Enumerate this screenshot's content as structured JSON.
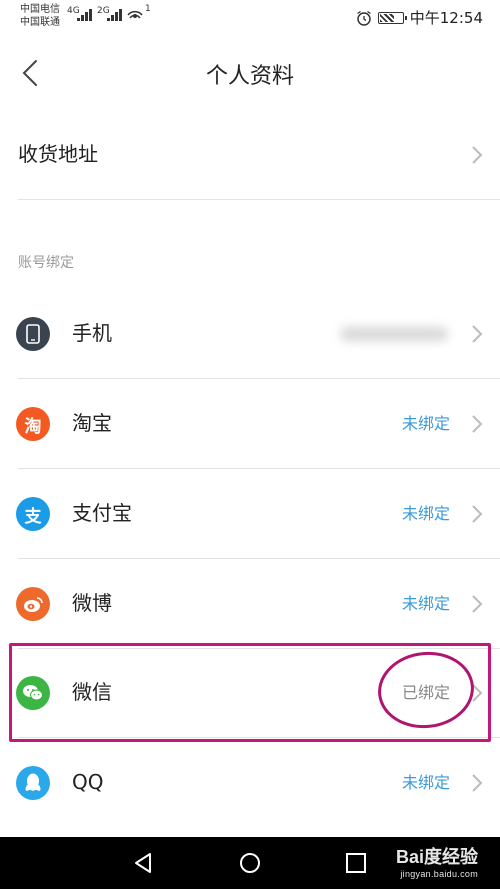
{
  "status_bar": {
    "carrier1": "中国电信",
    "carrier2": "中国联通",
    "net1": "4G",
    "net2": "2G",
    "hotspot_count": "1",
    "time": "中午12:54"
  },
  "nav": {
    "title": "个人资料"
  },
  "address": {
    "label": "收货地址"
  },
  "section_title": "账号绑定",
  "rows": [
    {
      "label": "手机",
      "icon": "phone-icon",
      "color": "#3a4450",
      "glyph": ""
    },
    {
      "label": "淘宝",
      "icon": "taobao-icon",
      "color": "#f25a22",
      "glyph": "淘",
      "status": "未绑定"
    },
    {
      "label": "支付宝",
      "icon": "alipay-icon",
      "color": "#1a9ce6",
      "glyph": "支",
      "status": "未绑定"
    },
    {
      "label": "微博",
      "icon": "weibo-icon",
      "color": "#ee6a2c",
      "glyph": "",
      "status": "未绑定"
    },
    {
      "label": "微信",
      "icon": "wechat-icon",
      "color": "#3cb544",
      "glyph": "",
      "status": "已绑定"
    },
    {
      "label": "QQ",
      "icon": "qq-icon",
      "color": "#2aa8ea",
      "glyph": "",
      "status": "未绑定"
    }
  ],
  "colors": {
    "link": "#3a9ad9",
    "annotation": "#c2187a"
  },
  "watermark": {
    "text": "Bai度经验",
    "sub": "jingyan.baidu.com"
  }
}
